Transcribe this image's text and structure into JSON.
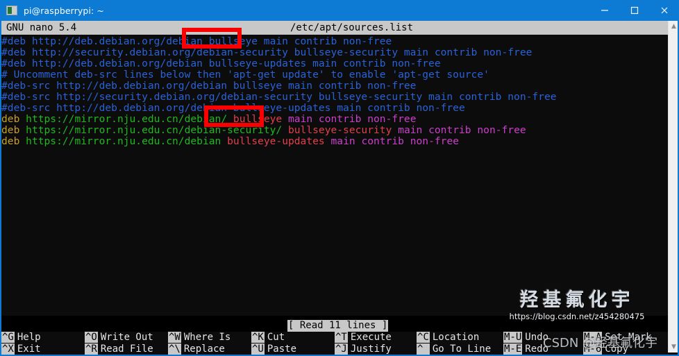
{
  "titlebar": {
    "title": "pi@raspberrypi: ~",
    "icon": "terminal-icon",
    "minimize": "minimize-icon",
    "maximize": "maximize-icon",
    "close": "close-icon"
  },
  "nano": {
    "version_label": "GNU nano 5.4",
    "filename": "/etc/apt/sources.list",
    "status_message": "[ Read 11 lines ]"
  },
  "editor": {
    "lines": [
      {
        "id": 1,
        "type": "comment",
        "text": "#deb http://deb.debian.org/debian bullseye main contrib non-free"
      },
      {
        "id": 2,
        "type": "comment",
        "text": "#deb http://security.debian.org/debian-security bullseye-security main contrib non-free"
      },
      {
        "id": 3,
        "type": "comment",
        "text": "#deb http://deb.debian.org/debian bullseye-updates main contrib non-free"
      },
      {
        "id": 4,
        "type": "comment",
        "text": "# Uncomment deb-src lines below then 'apt-get update' to enable 'apt-get source'"
      },
      {
        "id": 5,
        "type": "comment",
        "text": "#deb-src http://deb.debian.org/debian bullseye main contrib non-free"
      },
      {
        "id": 6,
        "type": "comment",
        "text": "#deb-src http://security.debian.org/debian-security bullseye-security main contrib non-free"
      },
      {
        "id": 7,
        "type": "comment",
        "text": "#deb-src http://deb.debian.org/debian bullseye-updates main contrib non-free"
      },
      {
        "id": 8,
        "type": "active",
        "keyword": "deb",
        "url": "https://mirror.nju.edu.cn/debian/",
        "suite": "bullseye",
        "components": "main contrib non-free"
      },
      {
        "id": 9,
        "type": "active",
        "keyword": "deb",
        "url": "https://mirror.nju.edu.cn/debian-security/",
        "suite": "bullseye-security",
        "components": "main contrib non-free"
      },
      {
        "id": 10,
        "type": "active",
        "keyword": "deb",
        "url": "https://mirror.nju.edu.cn/debian",
        "suite": "bullseye-updates",
        "components": "main contrib non-free"
      }
    ]
  },
  "shortcuts": [
    {
      "key": "^G",
      "label": "Help",
      "col": 0,
      "row": 0
    },
    {
      "key": "^X",
      "label": "Exit",
      "col": 0,
      "row": 1
    },
    {
      "key": "^O",
      "label": "Write Out",
      "col": 1,
      "row": 0
    },
    {
      "key": "^R",
      "label": "Read File",
      "col": 1,
      "row": 1
    },
    {
      "key": "^W",
      "label": "Where Is",
      "col": 2,
      "row": 0
    },
    {
      "key": "^\\",
      "label": "Replace",
      "col": 2,
      "row": 1
    },
    {
      "key": "^K",
      "label": "Cut",
      "col": 3,
      "row": 0
    },
    {
      "key": "^U",
      "label": "Paste",
      "col": 3,
      "row": 1
    },
    {
      "key": "^T",
      "label": "Execute",
      "col": 4,
      "row": 0
    },
    {
      "key": "^J",
      "label": "Justify",
      "col": 4,
      "row": 1
    },
    {
      "key": "^C",
      "label": "Location",
      "col": 5,
      "row": 0
    },
    {
      "key": "^ ",
      "label": "Go To Line",
      "col": 5,
      "row": 1
    },
    {
      "key": "M-U",
      "label": "Undo",
      "col": 6,
      "row": 0
    },
    {
      "key": "M-E",
      "label": "Redo",
      "col": 6,
      "row": 1
    },
    {
      "key": "M-A",
      "label": "Set Mark",
      "col": 7,
      "row": 0
    },
    {
      "key": "M-6",
      "label": "Copy",
      "col": 7,
      "row": 1
    }
  ],
  "annotations": {
    "highlight_1_text": "bullseye",
    "highlight_2_text": "bullseye",
    "color": "#fb0000"
  },
  "watermark": {
    "name": "羟基氟化宇",
    "url": "https://blog.csdn.net/z454280475",
    "brand": "CSDN @羟基氟化宇"
  },
  "scrollbar": {
    "up_arrow": "chevron-up-icon",
    "down_arrow": "chevron-down-icon"
  }
}
